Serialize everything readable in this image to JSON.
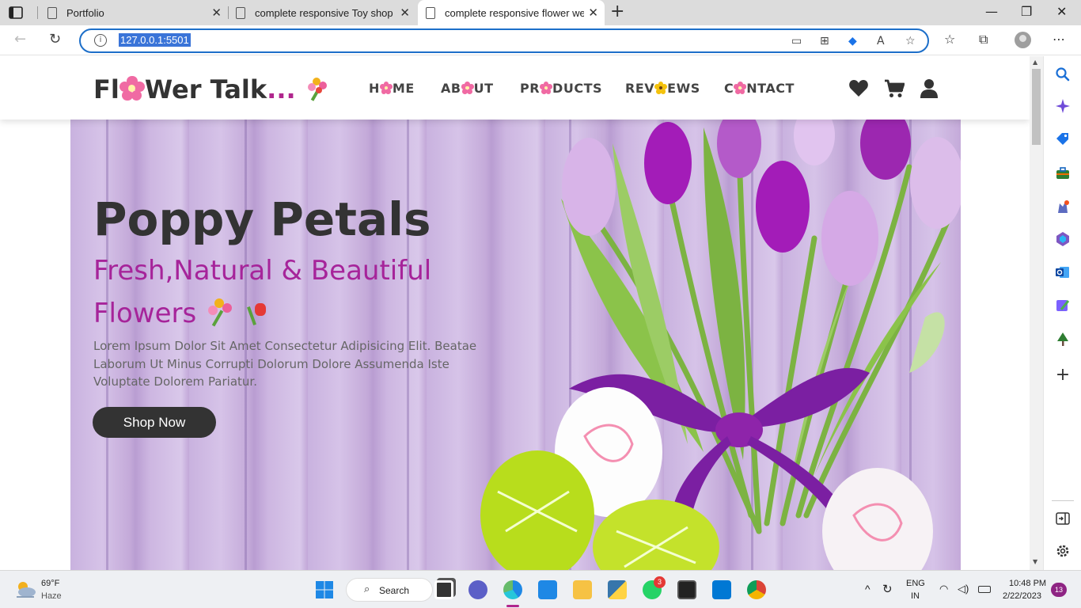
{
  "browser": {
    "tabs": [
      {
        "title": "Portfolio"
      },
      {
        "title": "complete responsive Toy shop we"
      },
      {
        "title": "complete responsive flower webs"
      }
    ],
    "address": {
      "url": "127.0.0.1:5501"
    }
  },
  "site": {
    "logo": {
      "part1": "Fl",
      "part2": "Wer Talk",
      "dots": "..."
    },
    "nav": [
      {
        "pre": "H",
        "post": "ME"
      },
      {
        "pre": "AB",
        "post": "UT"
      },
      {
        "pre": "PR",
        "post": "DUCTS"
      },
      {
        "pre": "REV",
        "post": "EWS"
      },
      {
        "pre": "C",
        "post": "NTACT"
      }
    ],
    "hero": {
      "title": "Poppy Petals",
      "subtitle": "Fresh,Natural & Beautiful Flowers",
      "text": "Lorem Ipsum Dolor Sit Amet Consectetur Adipisicing Elit. Beatae Laborum Ut Minus Corrupti Dolorum Dolore Assumenda Iste Voluptate Dolorem Pariatur.",
      "cta": "Shop Now"
    }
  },
  "taskbar": {
    "weather": {
      "temp": "69°F",
      "condition": "Haze"
    },
    "search_label": "Search",
    "lang": {
      "line1": "ENG",
      "line2": "IN"
    },
    "clock": {
      "time": "10:48 PM",
      "date": "2/22/2023"
    },
    "whatsapp_badge": "3",
    "notification_count": "13"
  },
  "colors": {
    "accent": "#a6249a",
    "address_focus": "#1d6fc9",
    "button_dark": "#333333"
  }
}
